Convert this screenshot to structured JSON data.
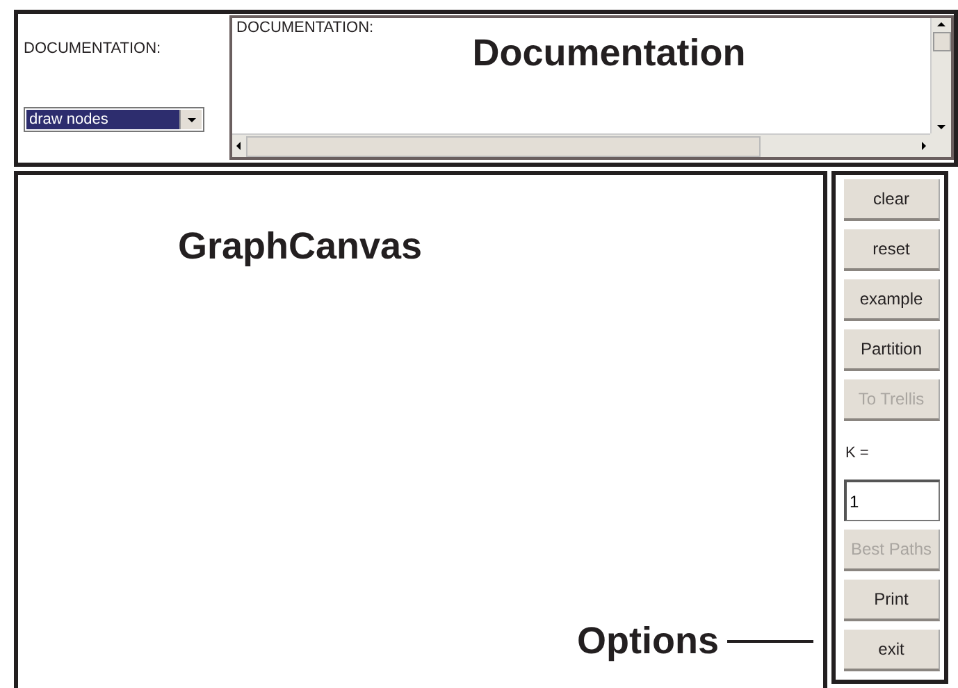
{
  "documentation": {
    "label": "DOCUMENTATION:",
    "mode_select": {
      "value": "draw nodes"
    },
    "text_area": {
      "header": "DOCUMENTATION:",
      "title": "Documentation"
    }
  },
  "canvas": {
    "title": "GraphCanvas"
  },
  "options": {
    "annotation": "Options",
    "items": [
      {
        "kind": "button",
        "label": "clear",
        "disabled": false
      },
      {
        "kind": "button",
        "label": "reset",
        "disabled": false
      },
      {
        "kind": "button",
        "label": "example",
        "disabled": false
      },
      {
        "kind": "button",
        "label": "Partition",
        "disabled": false
      },
      {
        "kind": "button",
        "label": "To Trellis",
        "disabled": true
      },
      {
        "kind": "label",
        "label": "K ="
      },
      {
        "kind": "field",
        "value": "1"
      },
      {
        "kind": "button",
        "label": "Best Paths",
        "disabled": true
      },
      {
        "kind": "button",
        "label": "Print",
        "disabled": false
      },
      {
        "kind": "button",
        "label": "exit",
        "disabled": false
      }
    ]
  }
}
